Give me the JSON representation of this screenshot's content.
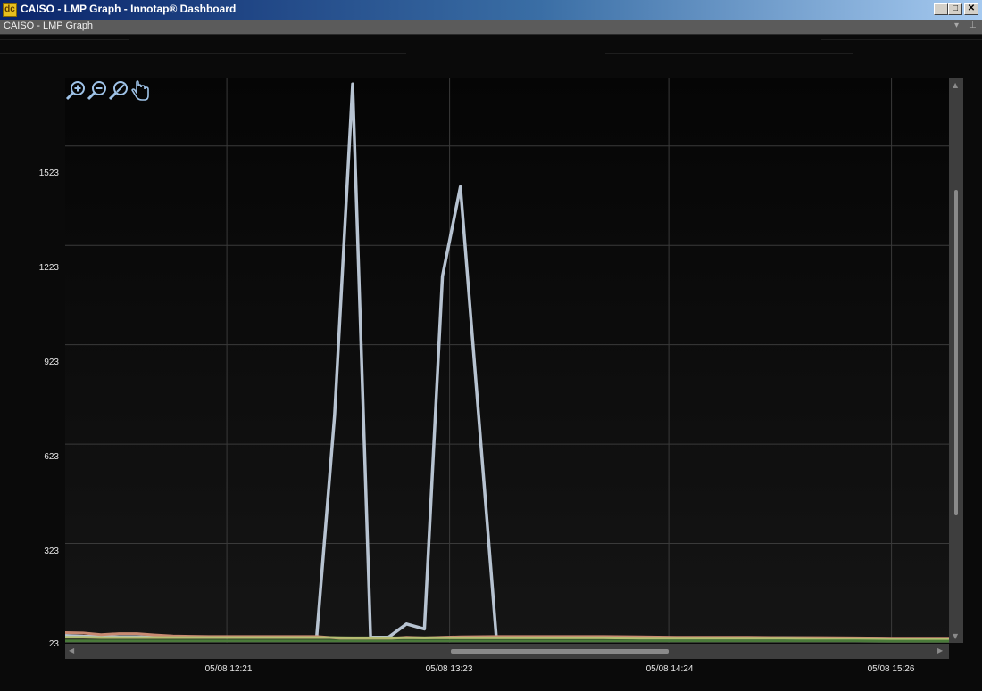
{
  "window": {
    "title": "CAISO - LMP Graph - Innotap® Dashboard",
    "icon": "app-logo-icon",
    "minimize_label": "_",
    "maximize_label": "□",
    "close_label": "✕"
  },
  "panel": {
    "title": "CAISO - LMP Graph",
    "dropdown_icon": "▾",
    "pin_icon": "⊥"
  },
  "toolbar": {
    "tools": [
      "zoom-in-icon",
      "zoom-out-icon",
      "zoom-reset-icon",
      "pan-hand-icon"
    ]
  },
  "colors": {
    "background": "#0a0a0a",
    "grid": "#3a3a3a",
    "spike_series": "#b7c3d1",
    "toolbar_icon": "#9fc3e8"
  },
  "chart_data": {
    "type": "line",
    "y_ticks": [
      "1523",
      "1223",
      "923",
      "623",
      "323",
      "23"
    ],
    "x_ticks": [
      "05/08 12:21",
      "05/08 13:23",
      "05/08 14:24",
      "05/08 15:26"
    ],
    "ylim": [
      23,
      1727
    ],
    "xlim": [
      "05/08 11:36",
      "05/08 15:42"
    ],
    "grid": true,
    "series": [
      {
        "color": "#b7c3d1",
        "x": [
          "05/08 11:36",
          "05/08 11:41",
          "05/08 11:46",
          "05/08 11:51",
          "05/08 11:56",
          "05/08 12:01",
          "05/08 12:06",
          "05/08 12:11",
          "05/08 12:16",
          "05/08 12:21",
          "05/08 12:26",
          "05/08 12:31",
          "05/08 12:36",
          "05/08 12:41",
          "05/08 12:46",
          "05/08 12:51",
          "05/08 12:56",
          "05/08 13:01",
          "05/08 13:06",
          "05/08 13:11",
          "05/08 13:16",
          "05/08 13:21",
          "05/08 13:26",
          "05/08 13:36",
          "05/08 13:46",
          "05/08 13:56",
          "05/08 14:06",
          "05/08 14:16",
          "05/08 14:26",
          "05/08 14:36",
          "05/08 14:46",
          "05/08 14:56",
          "05/08 15:06",
          "05/08 15:16",
          "05/08 15:26",
          "05/08 15:36",
          "05/08 15:42"
        ],
        "values": [
          45,
          43,
          42,
          41,
          41,
          40,
          40,
          40,
          40,
          40,
          40,
          40,
          40,
          40,
          40,
          710,
          1710,
          40,
          40,
          80,
          65,
          1130,
          1400,
          40,
          40,
          40,
          40,
          38,
          38,
          38,
          38,
          38,
          37,
          37,
          36,
          36,
          36
        ]
      },
      {
        "color": "#c98a72",
        "x": [
          "05/08 11:36",
          "05/08 11:41",
          "05/08 11:46",
          "05/08 11:51",
          "05/08 11:56",
          "05/08 12:01",
          "05/08 12:06",
          "05/08 12:11",
          "05/08 12:16",
          "05/08 12:21",
          "05/08 12:26",
          "05/08 12:31",
          "05/08 12:36",
          "05/08 12:41",
          "05/08 12:46",
          "05/08 12:51",
          "05/08 12:56",
          "05/08 13:01",
          "05/08 13:06",
          "05/08 13:11",
          "05/08 13:16",
          "05/08 13:21",
          "05/08 13:26",
          "05/08 13:36",
          "05/08 13:46",
          "05/08 13:56",
          "05/08 14:06",
          "05/08 14:16",
          "05/08 14:26",
          "05/08 14:36",
          "05/08 14:46",
          "05/08 14:56",
          "05/08 15:06",
          "05/08 15:16",
          "05/08 15:26",
          "05/08 15:36",
          "05/08 15:42"
        ],
        "values": [
          54,
          53,
          48,
          51,
          51,
          47,
          44,
          43,
          42,
          42,
          42,
          42,
          42,
          42,
          42,
          38,
          33,
          32,
          36,
          40,
          38,
          40,
          41,
          42,
          42,
          42,
          42,
          41,
          40,
          40,
          40,
          39,
          39,
          38,
          37,
          37,
          37
        ]
      },
      {
        "color": "#b4bf72",
        "x": [
          "05/08 11:36",
          "05/08 11:41",
          "05/08 11:46",
          "05/08 11:51",
          "05/08 11:56",
          "05/08 12:01",
          "05/08 12:06",
          "05/08 12:11",
          "05/08 12:16",
          "05/08 12:21",
          "05/08 12:26",
          "05/08 12:31",
          "05/08 12:36",
          "05/08 12:41",
          "05/08 12:46",
          "05/08 12:51",
          "05/08 12:56",
          "05/08 13:01",
          "05/08 13:06",
          "05/08 13:11",
          "05/08 13:16",
          "05/08 13:21",
          "05/08 13:26",
          "05/08 13:36",
          "05/08 13:46",
          "05/08 13:56",
          "05/08 14:06",
          "05/08 14:16",
          "05/08 14:26",
          "05/08 14:36",
          "05/08 14:46",
          "05/08 14:56",
          "05/08 15:06",
          "05/08 15:16",
          "05/08 15:26",
          "05/08 15:36",
          "05/08 15:42"
        ],
        "values": [
          40,
          40,
          39,
          39,
          39,
          39,
          39,
          39,
          39,
          39,
          39,
          39,
          39,
          39,
          39,
          39,
          38,
          38,
          38,
          38,
          38,
          38,
          38,
          38,
          38,
          38,
          38,
          37,
          37,
          37,
          37,
          37,
          36,
          36,
          35,
          35,
          35
        ]
      },
      {
        "color": "#4a7a3a",
        "x": [
          "05/08 11:36",
          "05/08 11:41",
          "05/08 11:46",
          "05/08 11:51",
          "05/08 11:56",
          "05/08 12:01",
          "05/08 12:06",
          "05/08 12:11",
          "05/08 12:16",
          "05/08 12:21",
          "05/08 12:26",
          "05/08 12:31",
          "05/08 12:36",
          "05/08 12:41",
          "05/08 12:46",
          "05/08 12:51",
          "05/08 12:56",
          "05/08 13:01",
          "05/08 13:06",
          "05/08 13:11",
          "05/08 13:16",
          "05/08 13:21",
          "05/08 13:26",
          "05/08 13:36",
          "05/08 13:46",
          "05/08 13:56",
          "05/08 14:06",
          "05/08 14:16",
          "05/08 14:26",
          "05/08 14:36",
          "05/08 14:46",
          "05/08 14:56",
          "05/08 15:06",
          "05/08 15:16",
          "05/08 15:26",
          "05/08 15:36",
          "05/08 15:42"
        ],
        "values": [
          29,
          29,
          29,
          29,
          29,
          29,
          29,
          29,
          29,
          29,
          29,
          29,
          29,
          29,
          29,
          29,
          29,
          29,
          29,
          29,
          29,
          29,
          29,
          29,
          29,
          29,
          29,
          29,
          29,
          29,
          29,
          29,
          29,
          29,
          28,
          28,
          28
        ]
      }
    ]
  }
}
